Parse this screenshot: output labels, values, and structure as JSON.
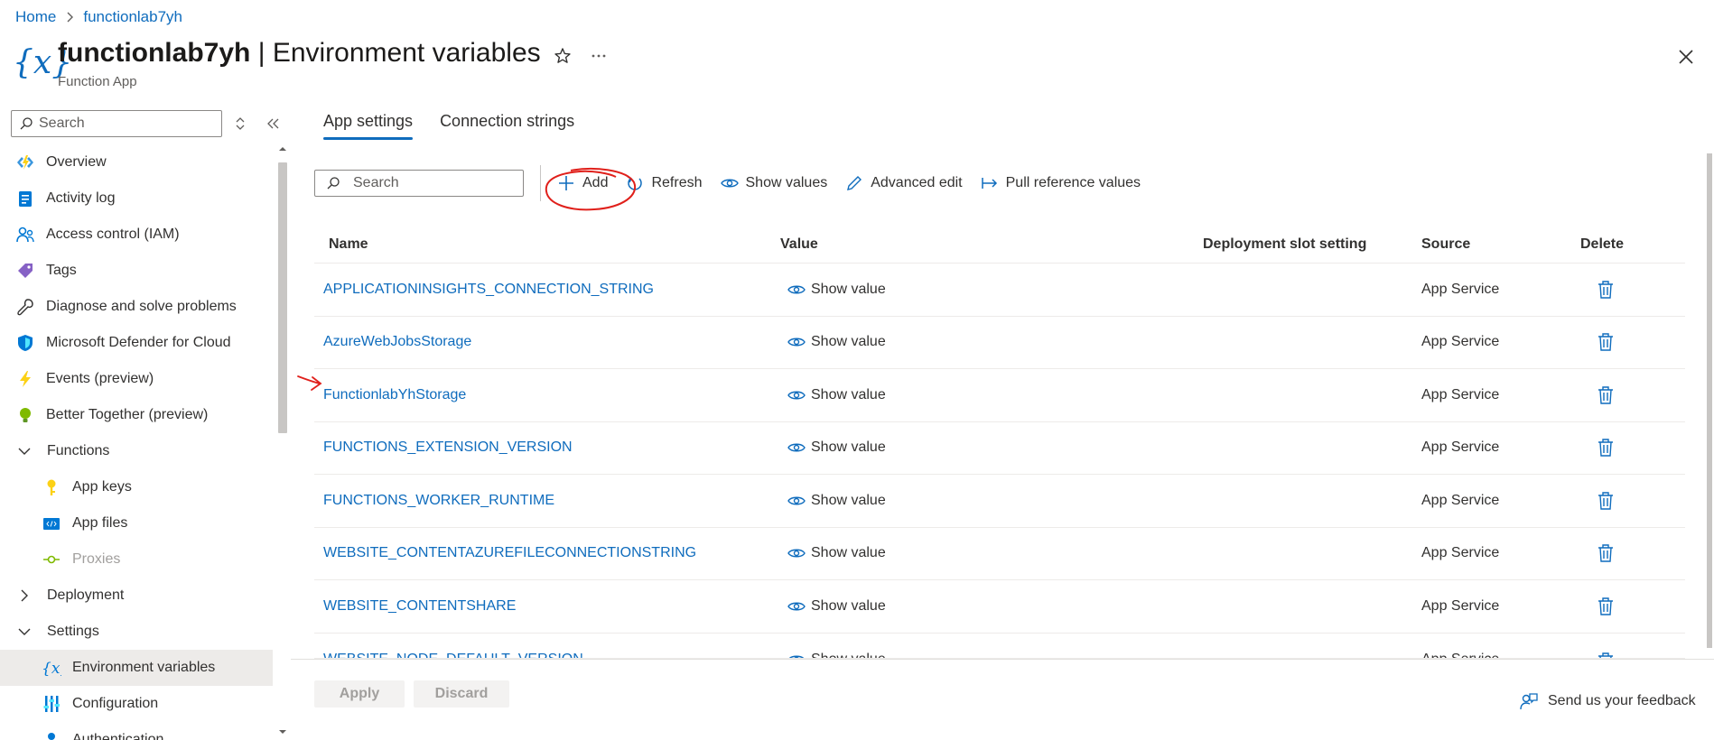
{
  "breadcrumb": {
    "home": "Home",
    "resource": "functionlab7yh"
  },
  "header": {
    "icon_glyph": "{x}",
    "title_bold": "functionlab7yh",
    "title_rest": "| Environment variables",
    "subtitle": "Function App",
    "star_icon": "star-icon",
    "more_icon": "more-icon",
    "close_icon": "close-icon"
  },
  "sidebar": {
    "search_placeholder": "Search",
    "items": [
      {
        "label": "Overview",
        "icon": "function-app-icon"
      },
      {
        "label": "Activity log",
        "icon": "activity-log-icon"
      },
      {
        "label": "Access control (IAM)",
        "icon": "people-icon"
      },
      {
        "label": "Tags",
        "icon": "tag-icon"
      },
      {
        "label": "Diagnose and solve problems",
        "icon": "wrench-icon"
      },
      {
        "label": "Microsoft Defender for Cloud",
        "icon": "shield-icon"
      },
      {
        "label": "Events (preview)",
        "icon": "lightning-icon"
      },
      {
        "label": "Better Together (preview)",
        "icon": "lightbulb-icon"
      },
      {
        "label": "Functions",
        "icon": "chevron-down-icon"
      },
      {
        "label": "App keys",
        "icon": "key-icon"
      },
      {
        "label": "App files",
        "icon": "code-file-icon"
      },
      {
        "label": "Proxies",
        "icon": "proxy-icon"
      },
      {
        "label": "Deployment",
        "icon": "chevron-right-icon"
      },
      {
        "label": "Settings",
        "icon": "chevron-down-icon"
      },
      {
        "label": "Environment variables",
        "icon": "variable-icon"
      },
      {
        "label": "Configuration",
        "icon": "configuration-icon"
      },
      {
        "label": "Authentication",
        "icon": "authentication-icon"
      }
    ]
  },
  "tabs": [
    {
      "label": "App settings",
      "active": true
    },
    {
      "label": "Connection strings",
      "active": false
    }
  ],
  "toolbar": {
    "search_placeholder": "Search",
    "add": "Add",
    "refresh": "Refresh",
    "show_values": "Show values",
    "advanced_edit": "Advanced edit",
    "pull_reference": "Pull reference values"
  },
  "table": {
    "headers": {
      "name": "Name",
      "value": "Value",
      "slot": "Deployment slot setting",
      "source": "Source",
      "delete": "Delete"
    },
    "rows": [
      {
        "name": "APPLICATIONINSIGHTS_CONNECTION_STRING",
        "value": "Show value",
        "source": "App Service"
      },
      {
        "name": "AzureWebJobsStorage",
        "value": "Show value",
        "source": "App Service"
      },
      {
        "name": "FunctionlabYhStorage",
        "value": "Show value",
        "source": "App Service"
      },
      {
        "name": "FUNCTIONS_EXTENSION_VERSION",
        "value": "Show value",
        "source": "App Service"
      },
      {
        "name": "FUNCTIONS_WORKER_RUNTIME",
        "value": "Show value",
        "source": "App Service"
      },
      {
        "name": "WEBSITE_CONTENTAZUREFILECONNECTIONSTRING",
        "value": "Show value",
        "source": "App Service"
      },
      {
        "name": "WEBSITE_CONTENTSHARE",
        "value": "Show value",
        "source": "App Service"
      },
      {
        "name": "WEBSITE_NODE_DEFAULT_VERSION",
        "value": "Show value",
        "source": "App Service"
      }
    ]
  },
  "footer": {
    "apply": "Apply",
    "discard": "Discard",
    "feedback": "Send us your feedback"
  },
  "colors": {
    "accent": "#0f6cbd",
    "annotation": "#e0201b",
    "selected_bg": "#edebe9"
  }
}
